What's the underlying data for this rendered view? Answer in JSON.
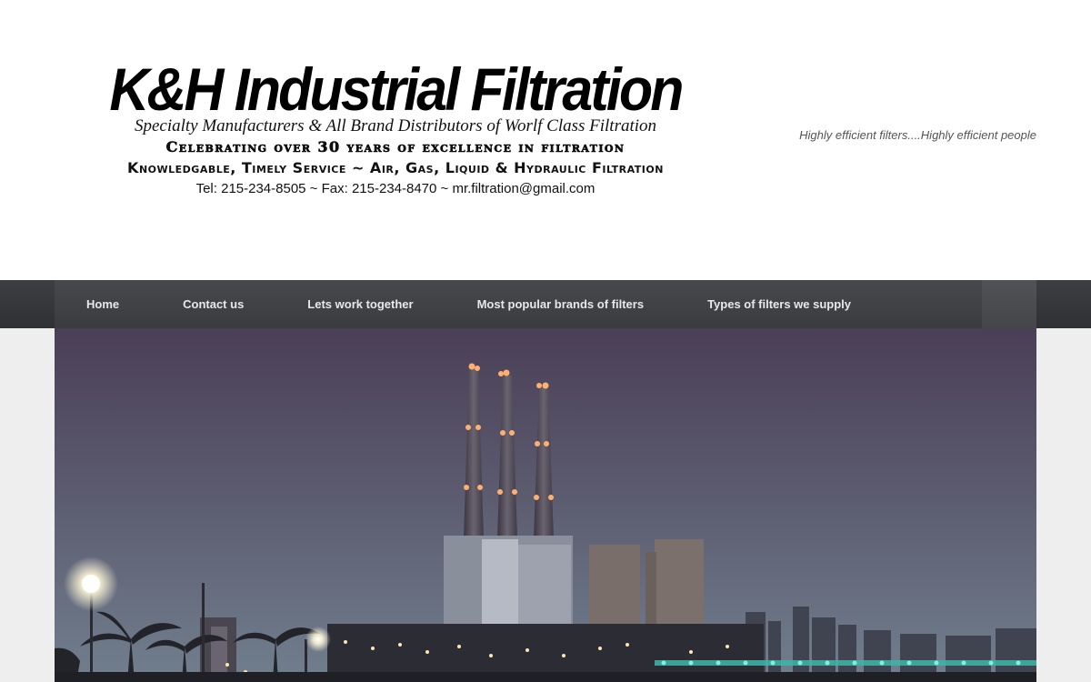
{
  "header": {
    "title": "K&H Industrial Filtration",
    "subtitle": "Specialty Manufacturers & All Brand Distributors of Worlf Class Filtration",
    "celebrating": "Celebrating over 30 years of excellence in filtration",
    "service": "Knowledgable, Timely Service ~ Air, Gas, Liquid & Hydraulic Filtration",
    "contact": "Tel: 215-234-8505 ~ Fax: 215-234-8470 ~ mr.filtration@gmail.com",
    "tagline": "Highly efficient filters....Highly efficient people"
  },
  "nav": {
    "items": [
      {
        "label": "Home"
      },
      {
        "label": "Contact us"
      },
      {
        "label": "Lets work together"
      },
      {
        "label": "Most popular brands of filters"
      },
      {
        "label": "Types of filters we supply"
      }
    ]
  },
  "hero": {
    "description_icon": "power-plant-night-photo"
  },
  "colors": {
    "nav_bg": "#3c3e42",
    "nav_text": "#e8e8e8",
    "content_bg": "#eeeeee",
    "sky_top": "#4a3f56",
    "sky_bottom": "#6c7a8a"
  }
}
